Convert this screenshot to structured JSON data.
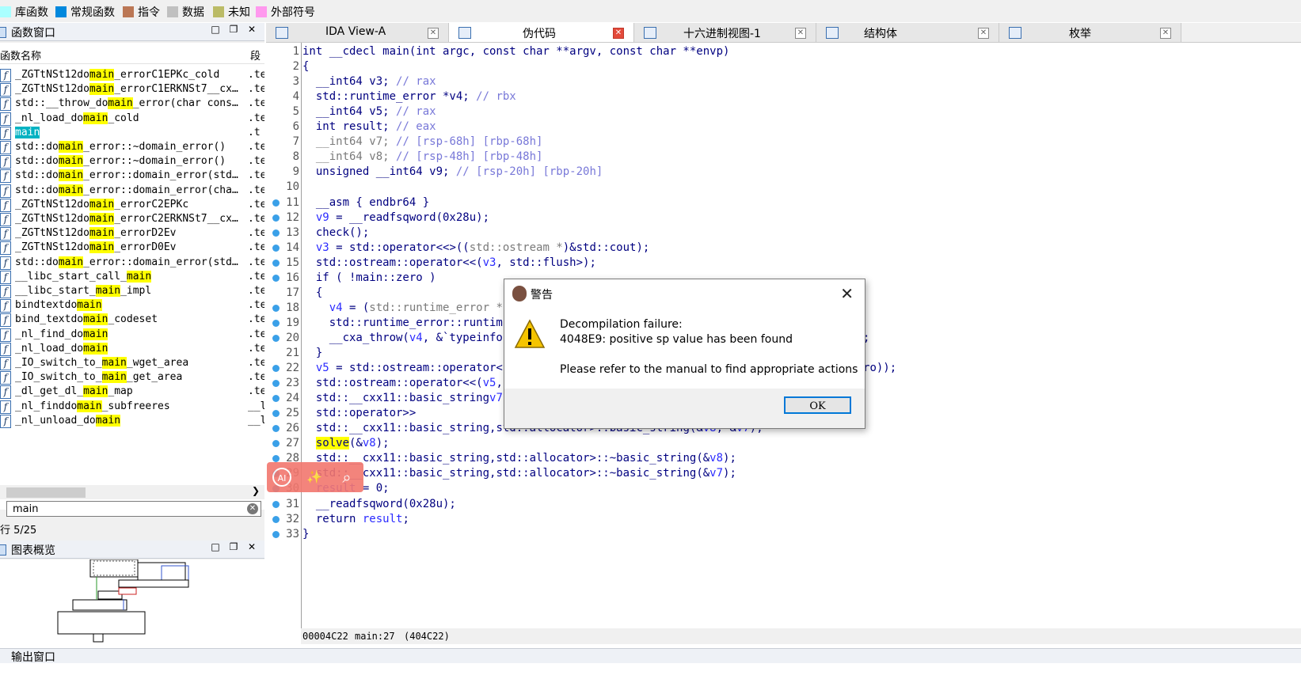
{
  "legend": [
    {
      "label": "库函数",
      "color": "#aaffff"
    },
    {
      "label": "常规函数",
      "color": "#0088dd"
    },
    {
      "label": "指令",
      "color": "#bb7755"
    },
    {
      "label": "数据",
      "color": "#c0c0c0"
    },
    {
      "label": "未知",
      "color": "#bbbb66"
    },
    {
      "label": "外部符号",
      "color": "#ff99ee"
    }
  ],
  "functions_window": {
    "title": "函数窗口",
    "col_name": "函数名称",
    "col_segment": "段",
    "rows": [
      {
        "pre": "_ZGTtNSt12do",
        "hl": "main",
        "post": "_errorC1EPKc_cold",
        "seg": ".te"
      },
      {
        "pre": "_ZGTtNSt12do",
        "hl": "main",
        "post": "_errorC1ERKNSt7__cx…",
        "seg": ".te"
      },
      {
        "pre": "std::__throw_do",
        "hl": "main",
        "post": "_error(char cons…",
        "seg": ".te"
      },
      {
        "pre": "_nl_load_do",
        "hl": "main",
        "post": "_cold",
        "seg": ".te"
      },
      {
        "pre": "",
        "hl": "main",
        "post": "",
        "seg": ".t",
        "selected": true
      },
      {
        "pre": "std::do",
        "hl": "main",
        "post": "_error::~domain_error()",
        "seg": ".te"
      },
      {
        "pre": "std::do",
        "hl": "main",
        "post": "_error::~domain_error()",
        "seg": ".te"
      },
      {
        "pre": "std::do",
        "hl": "main",
        "post": "_error::domain_error(std…",
        "seg": ".te"
      },
      {
        "pre": "std::do",
        "hl": "main",
        "post": "_error::domain_error(cha…",
        "seg": ".te"
      },
      {
        "pre": "_ZGTtNSt12do",
        "hl": "main",
        "post": "_errorC2EPKc",
        "seg": ".te"
      },
      {
        "pre": "_ZGTtNSt12do",
        "hl": "main",
        "post": "_errorC2ERKNSt7__cx…",
        "seg": ".te"
      },
      {
        "pre": "_ZGTtNSt12do",
        "hl": "main",
        "post": "_errorD2Ev",
        "seg": ".te"
      },
      {
        "pre": "_ZGTtNSt12do",
        "hl": "main",
        "post": "_errorD0Ev",
        "seg": ".te"
      },
      {
        "pre": "std::do",
        "hl": "main",
        "post": "_error::domain_error(std…",
        "seg": ".te"
      },
      {
        "pre": "__libc_start_call_",
        "hl": "main",
        "post": "",
        "seg": ".te"
      },
      {
        "pre": "__libc_start_",
        "hl": "main",
        "post": "_impl",
        "seg": ".te"
      },
      {
        "pre": "bindtextdo",
        "hl": "main",
        "post": "",
        "seg": ".te"
      },
      {
        "pre": "bind_textdo",
        "hl": "main",
        "post": "_codeset",
        "seg": ".te"
      },
      {
        "pre": "_nl_find_do",
        "hl": "main",
        "post": "",
        "seg": ".te"
      },
      {
        "pre": "_nl_load_do",
        "hl": "main",
        "post": "",
        "seg": ".te"
      },
      {
        "pre": "_IO_switch_to_",
        "hl": "main",
        "post": "_wget_area",
        "seg": ".te"
      },
      {
        "pre": "_IO_switch_to_",
        "hl": "main",
        "post": "_get_area",
        "seg": ".te"
      },
      {
        "pre": "_dl_get_dl_",
        "hl": "main",
        "post": "_map",
        "seg": ".te"
      },
      {
        "pre": "_nl_finddo",
        "hl": "main",
        "post": "_subfreeres",
        "seg": "__l"
      },
      {
        "pre": "_nl_unload_do",
        "hl": "main",
        "post": "",
        "seg": "__l"
      }
    ],
    "search_value": "main",
    "row_count": "行 5/25"
  },
  "graph_window": {
    "title": "图表概览"
  },
  "output_window": {
    "title": "输出窗口"
  },
  "tabs": [
    {
      "label": "IDA View-A",
      "active": false
    },
    {
      "label": "伪代码",
      "active": true
    },
    {
      "label": "十六进制视图-1",
      "active": false
    },
    {
      "label": "结构体",
      "active": false
    },
    {
      "label": "枚举",
      "active": false
    }
  ],
  "code_lines": [
    {
      "n": "1",
      "dot": false,
      "html": "int __cdecl main(int argc, const char **argv, const char **envp)"
    },
    {
      "n": "2",
      "dot": false,
      "html": "{"
    },
    {
      "n": "3",
      "dot": false,
      "html": "  __int64 v3; <span class=\"cmt\">// rax</span>"
    },
    {
      "n": "4",
      "dot": false,
      "html": "  std::runtime_error *v4; <span class=\"cmt\">// rbx</span>"
    },
    {
      "n": "5",
      "dot": false,
      "html": "  __int64 v5; <span class=\"cmt\">// rax</span>"
    },
    {
      "n": "6",
      "dot": false,
      "html": "  int result; <span class=\"cmt\">// eax</span>"
    },
    {
      "n": "7",
      "dot": false,
      "html": "  <span class=\"gry\">__int64 v7;</span> <span class=\"cmt\">// [rsp-68h] [rbp-68h]</span>"
    },
    {
      "n": "8",
      "dot": false,
      "html": "  <span class=\"gry\">__int64 v8;</span> <span class=\"cmt\">// [rsp-48h] [rbp-48h]</span>"
    },
    {
      "n": "9",
      "dot": false,
      "html": "  unsigned __int64 v9; <span class=\"cmt\">// [rsp-20h] [rbp-20h]</span>"
    },
    {
      "n": "10",
      "dot": false,
      "html": ""
    },
    {
      "n": "11",
      "dot": true,
      "html": "  __asm { endbr64 }"
    },
    {
      "n": "12",
      "dot": true,
      "html": "  <span class=\"var\">v9</span> = __readfsqword(0x28u);"
    },
    {
      "n": "13",
      "dot": true,
      "html": "  check();"
    },
    {
      "n": "14",
      "dot": true,
      "html": "  <span class=\"var\">v3</span> = std::operator<<<std::char_traits<char>>((<span class=\"gry\">std::ostream *</span>)&std::cout);"
    },
    {
      "n": "15",
      "dot": true,
      "html": "  std::ostream::operator<<(<span class=\"var\">v3</span>, std::flush<char,std::char_traits<char>>);"
    },
    {
      "n": "16",
      "dot": true,
      "html": "  if ( !main::zero )"
    },
    {
      "n": "17",
      "dot": false,
      "html": "  {"
    },
    {
      "n": "18",
      "dot": true,
      "html": "    <span class=\"var\">v4</span> = (<span class=\"gry\">std::runtime_error *</span>"
    },
    {
      "n": "19",
      "dot": true,
      "html": "    std::runtime_error::runtim"
    },
    {
      "n": "20",
      "dot": true,
      "html": "    __cxa_throw(<span class=\"var\">v4</span>, &`typeinfo                                               _error);"
    },
    {
      "n": "21",
      "dot": false,
      "html": "  }"
    },
    {
      "n": "22",
      "dot": true,
      "html": "  <span class=\"var\">v5</span> = std::ostream::operator<                                               ain::zero));"
    },
    {
      "n": "23",
      "dot": true,
      "html": "  std::ostream::operator<<(<span class=\"var\">v5</span>,"
    },
    {
      "n": "24",
      "dot": true,
      "html": "  std::__cxx11::basic_string<c                                               asic_string(&<span class=\"var\">v7</span>);"
    },
    {
      "n": "25",
      "dot": true,
      "html": "  std::operator>><char,std::ch                                               )&std::cin);"
    },
    {
      "n": "26",
      "dot": true,
      "html": "  std::__cxx11::basic_string<char,std::char_traits<char>,std::allocator<char>>::basic_string(&<span class=\"var\">v8</span>, &<span class=\"var\">v7</span>);"
    },
    {
      "n": "27",
      "dot": true,
      "html": "  <span class=\"hl\">solve</span>(&<span class=\"var\">v8</span>);"
    },
    {
      "n": "28",
      "dot": true,
      "html": "  std::__cxx11::basic_string<char,std::char_traits<char>,std::allocator<char>>::~basic_string(&<span class=\"var\">v8</span>);"
    },
    {
      "n": "29",
      "dot": true,
      "html": "  std::__cxx11::basic_string<char,std::char_traits<char>,std::allocator<char>>::~basic_string(&<span class=\"var\">v7</span>);"
    },
    {
      "n": "30",
      "dot": true,
      "html": "  <span class=\"var\">result</span> = 0;"
    },
    {
      "n": "31",
      "dot": true,
      "html": "  __readfsqword(0x28u);"
    },
    {
      "n": "32",
      "dot": true,
      "html": "  return <span class=\"var\">result</span>;"
    },
    {
      "n": "33",
      "dot": true,
      "html": "}"
    }
  ],
  "status": {
    "addr": "00004C22",
    "loc": "main:27",
    "paren": "(404C22)"
  },
  "ai_toolbar": {
    "b1": "AI",
    "b2": "✨",
    "b3": "⌕"
  },
  "dialog": {
    "title": "警告",
    "line1": "Decompilation failure:",
    "line2": "4048E9: positive sp value has been found",
    "line3": "Please refer to the manual to find appropriate actions",
    "ok": "OK"
  }
}
